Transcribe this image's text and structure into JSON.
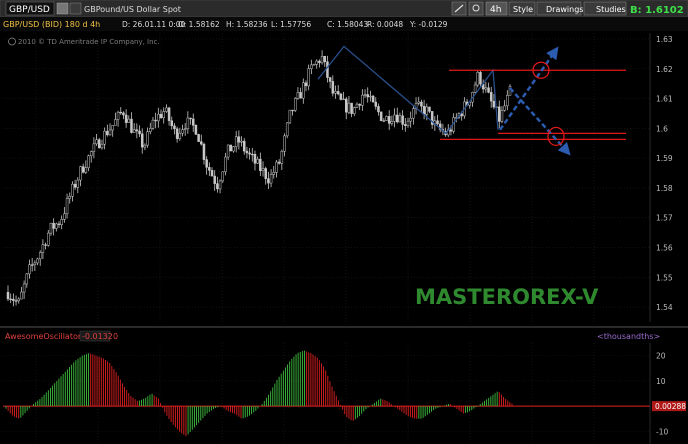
{
  "toolbar": {
    "symbol": "GBP/USD",
    "description": "GBPound/US Dollar Spot",
    "timeframe": "4h",
    "buttons": [
      "Style",
      "Drawings",
      "Studies"
    ],
    "bid_label": "B: 1.6102"
  },
  "info_bar": {
    "series_label": "GBP/USD (BID) 180 d 4h",
    "fields": [
      "D: 26.01.11 0:00",
      "O: 1.58162",
      "H: 1.58236",
      "L: 1.57756",
      "C: 1.58043",
      "R: 0.0048",
      "Y: -0.0129"
    ]
  },
  "copyright": "2010 © TD Ameritrade IP Company, Inc.",
  "watermark": "MASTEROREX-V",
  "oscillator": {
    "name": "AwesomeOscillator",
    "value_label": "-0.0132",
    "extra": "0",
    "units": "<thousandths>",
    "current_tag": "0.00288"
  },
  "colors": {
    "background": "#000000",
    "candle": "#c8c8c8",
    "trendline": "#2a4f8c",
    "level": "#e01818",
    "arrow": "#2c5cb0",
    "ao_up": "#3fbf3f",
    "ao_down": "#e02020",
    "watermark": "#2f8a2f"
  },
  "chart_data": [
    {
      "type": "candlestick",
      "title": "GBP/USD (BID) 180 d 4h",
      "ylim": [
        1.535,
        1.632
      ],
      "y_ticks": [
        "1.54",
        "1.55",
        "1.56",
        "1.57",
        "1.58",
        "1.59",
        "1.6",
        "1.61",
        "1.62",
        "1.63"
      ],
      "close_path": [
        1.545,
        1.541,
        1.552,
        1.558,
        1.566,
        1.569,
        1.578,
        1.586,
        1.592,
        1.597,
        1.601,
        1.606,
        1.599,
        1.594,
        1.603,
        1.606,
        1.598,
        1.602,
        1.6,
        1.588,
        1.581,
        1.592,
        1.596,
        1.591,
        1.587,
        1.583,
        1.589,
        1.605,
        1.612,
        1.62,
        1.624,
        1.612,
        1.608,
        1.606,
        1.612,
        1.607,
        1.603,
        1.605,
        1.602,
        1.607,
        1.606,
        1.6,
        1.598,
        1.604,
        1.609,
        1.618,
        1.61,
        1.603,
        1.612
      ],
      "levels": [
        1.6195,
        1.5983,
        1.5963
      ],
      "annotation": "MASTEROREX-V"
    },
    {
      "type": "bar",
      "title": "AwesomeOscillator",
      "ylim": [
        -15,
        25
      ],
      "y_ticks": [
        "20",
        "10",
        "0",
        "-10"
      ],
      "values": [
        -1,
        -4,
        -5,
        -2,
        1,
        3,
        6,
        9,
        12,
        15,
        18,
        20,
        21,
        20,
        19,
        17,
        13,
        8,
        4,
        2,
        3,
        5,
        3,
        -3,
        -7,
        -10,
        -12,
        -9,
        -6,
        -3,
        -1,
        0,
        -2,
        -3,
        -5,
        -4,
        -2,
        1,
        5,
        10,
        14,
        18,
        21,
        22,
        21,
        19,
        15,
        8,
        2,
        -4,
        -6,
        -4,
        -1,
        1,
        3,
        2,
        0,
        -2,
        -4,
        -5,
        -5,
        -3,
        -1,
        0,
        1,
        -1,
        -3,
        -2,
        0,
        2,
        4,
        6,
        3,
        1
      ]
    }
  ]
}
